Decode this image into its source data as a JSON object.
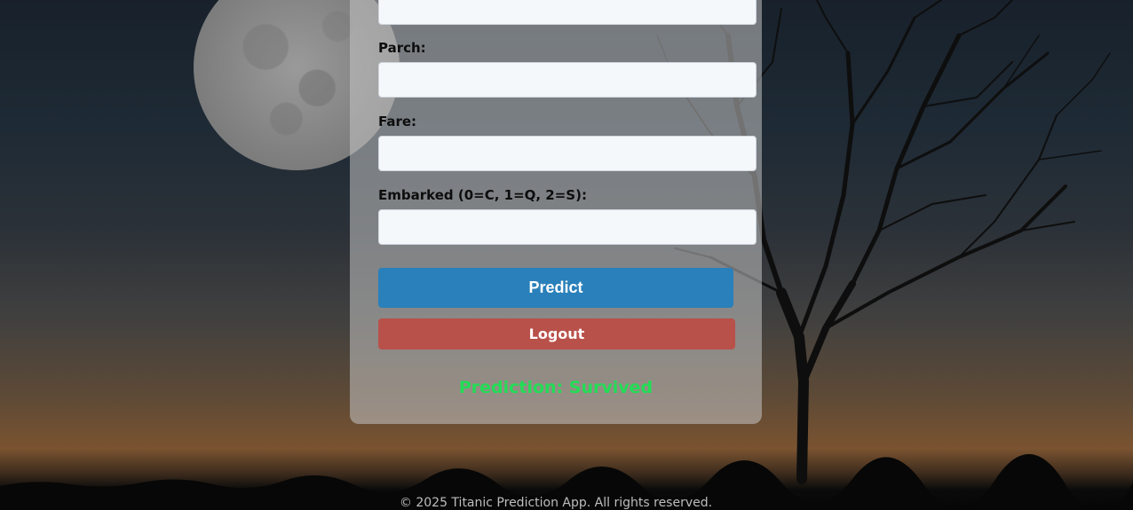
{
  "form": {
    "fields": [
      {
        "label": "",
        "value": "",
        "placeholder": ""
      },
      {
        "label": "Parch:",
        "value": "",
        "placeholder": ""
      },
      {
        "label": "Fare:",
        "value": "",
        "placeholder": ""
      },
      {
        "label": "Embarked (0=C, 1=Q, 2=S):",
        "value": "",
        "placeholder": ""
      }
    ],
    "predict_label": "Predict",
    "logout_label": "Logout",
    "result_text": "Prediction: Survived"
  },
  "footer": {
    "text": "© 2025 Titanic Prediction App. All rights reserved."
  },
  "colors": {
    "predict_button": "#2a80ba",
    "logout_button": "#b8514a",
    "result_text": "#22dd55"
  }
}
